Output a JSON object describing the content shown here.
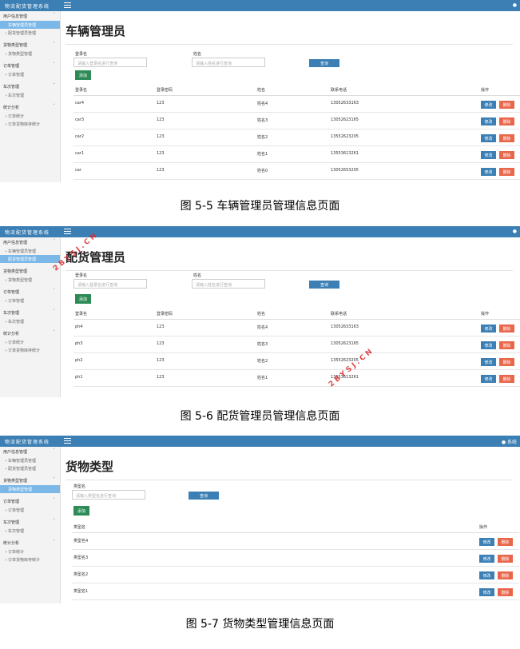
{
  "app_title": "物流配货管理系统",
  "user": "系统",
  "sidebar": [
    {
      "group": "用户信息管理",
      "items": [
        "车辆管理员管理",
        "配货管理员管理"
      ]
    },
    {
      "group": "货物类型管理",
      "items": [
        "货物类型管理"
      ]
    },
    {
      "group": "订单管理",
      "items": [
        "订单管理"
      ]
    },
    {
      "group": "车次管理",
      "items": [
        "车次管理"
      ]
    },
    {
      "group": "统计分析",
      "items": [
        "订单统计",
        "订单货物库存统计"
      ]
    }
  ],
  "screens": [
    {
      "title": "车辆管理员",
      "label_username": "登录名",
      "placeholder_username": "请输入登录名进行查询",
      "label_name": "姓名",
      "placeholder_name": "请输入姓名进行查询",
      "search_label": "查询",
      "add_label": "添加",
      "headers": [
        "登录名",
        "登录密码",
        "姓名",
        "联系电话",
        "操作"
      ],
      "rows": [
        [
          "car4",
          "123",
          "姓名4",
          "13052633163"
        ],
        [
          "car3",
          "123",
          "姓名3",
          "13052623165"
        ],
        [
          "car2",
          "123",
          "姓名2",
          "13552623205"
        ],
        [
          "car1",
          "123",
          "姓名1",
          "13553613261"
        ],
        [
          "car",
          "123",
          "姓名0",
          "13052653205"
        ]
      ],
      "edit_label": "修改",
      "delete_label": "删除",
      "caption": "图 5-5 车辆管理员管理信息页面"
    },
    {
      "title": "配货管理员",
      "label_username": "登录名",
      "placeholder_username": "请输入登录名进行查询",
      "label_name": "姓名",
      "placeholder_name": "请输入姓名进行查询",
      "search_label": "查询",
      "add_label": "添加",
      "headers": [
        "登录名",
        "登录密码",
        "姓名",
        "联系电话",
        "操作"
      ],
      "rows": [
        [
          "ph4",
          "123",
          "姓名4",
          "13052633163"
        ],
        [
          "ph3",
          "123",
          "姓名3",
          "13052623165"
        ],
        [
          "ph2",
          "123",
          "姓名2",
          "13552623205"
        ],
        [
          "ph1",
          "123",
          "姓名1",
          "13553613261"
        ]
      ],
      "edit_label": "修改",
      "delete_label": "删除",
      "caption": "图 5-6 配货管理员管理信息页面"
    },
    {
      "title": "货物类型",
      "label_type": "类型名",
      "placeholder_type": "请输入类型名进行查询",
      "search_label": "查询",
      "add_label": "添加",
      "headers": [
        "类型名",
        "操作"
      ],
      "rows": [
        [
          "类型名4"
        ],
        [
          "类型名3"
        ],
        [
          "类型名2"
        ],
        [
          "类型名1"
        ]
      ],
      "edit_label": "修改",
      "delete_label": "删除",
      "caption": "图 5-7 货物类型管理信息页面"
    }
  ],
  "watermark": "2BYSJ.CN",
  "colors": {
    "topbar": "#3b7fb4",
    "active": "#7bb8e8",
    "add": "#2e8b57",
    "delete": "#e8664a"
  }
}
